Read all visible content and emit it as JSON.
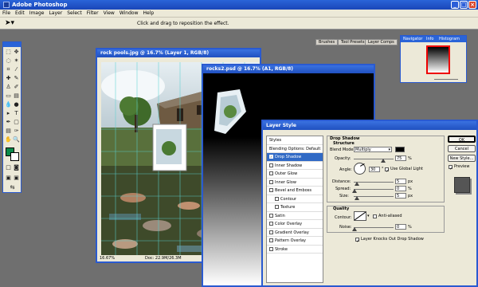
{
  "app": {
    "title": "Adobe Photoshop"
  },
  "menu": [
    "File",
    "Edit",
    "Image",
    "Layer",
    "Select",
    "Filter",
    "View",
    "Window",
    "Help"
  ],
  "options": {
    "hint": "Click and drag to reposition the effect."
  },
  "palette_tabs": [
    "Brushes",
    "Tool Presets",
    "Layer Comps"
  ],
  "navigator": {
    "tabs": [
      "Navigator",
      "Info",
      "Histogram"
    ]
  },
  "doc1": {
    "title": "rock pools.jpg @ 16.7% (Layer 1, RGB/8)",
    "zoom": "16.67%",
    "info": "Doc: 22.9M/26.3M"
  },
  "doc2": {
    "title": "rocks2.psd @ 16.7% (A1, RGB/8)"
  },
  "dialog": {
    "title": "Layer Style",
    "styles": [
      {
        "label": "Styles",
        "check": false,
        "hl": false
      },
      {
        "label": "Blending Options: Default",
        "check": false,
        "hl": false
      },
      {
        "label": "Drop Shadow",
        "check": true,
        "hl": true
      },
      {
        "label": "Inner Shadow",
        "check": true,
        "hl": false
      },
      {
        "label": "Outer Glow",
        "check": true,
        "hl": false
      },
      {
        "label": "Inner Glow",
        "check": true,
        "hl": false
      },
      {
        "label": "Bevel and Emboss",
        "check": true,
        "hl": false
      },
      {
        "label": "Contour",
        "check": true,
        "hl": false
      },
      {
        "label": "Texture",
        "check": true,
        "hl": false
      },
      {
        "label": "Satin",
        "check": true,
        "hl": false
      },
      {
        "label": "Color Overlay",
        "check": true,
        "hl": false
      },
      {
        "label": "Gradient Overlay",
        "check": true,
        "hl": false
      },
      {
        "label": "Pattern Overlay",
        "check": true,
        "hl": false
      },
      {
        "label": "Stroke",
        "check": true,
        "hl": false
      }
    ],
    "section": "Drop Shadow",
    "structure": "Structure",
    "blend_label": "Blend Mode:",
    "blend_value": "Multiply",
    "opacity_label": "Opacity:",
    "opacity": "75",
    "opacity_unit": "%",
    "angle_label": "Angle:",
    "angle": "30",
    "angle_unit": "°",
    "global_light": "Use Global Light",
    "distance_label": "Distance:",
    "distance": "5",
    "distance_unit": "px",
    "spread_label": "Spread:",
    "spread": "0",
    "spread_unit": "%",
    "size_label": "Size:",
    "size": "5",
    "size_unit": "px",
    "quality": "Quality",
    "contour_label": "Contour:",
    "antialiased": "Anti-aliased",
    "noise_label": "Noise:",
    "noise": "0",
    "noise_unit": "%",
    "knockout": "Layer Knocks Out Drop Shadow",
    "ok": "OK",
    "cancel": "Cancel",
    "new_style": "New Style...",
    "preview": "Preview"
  }
}
